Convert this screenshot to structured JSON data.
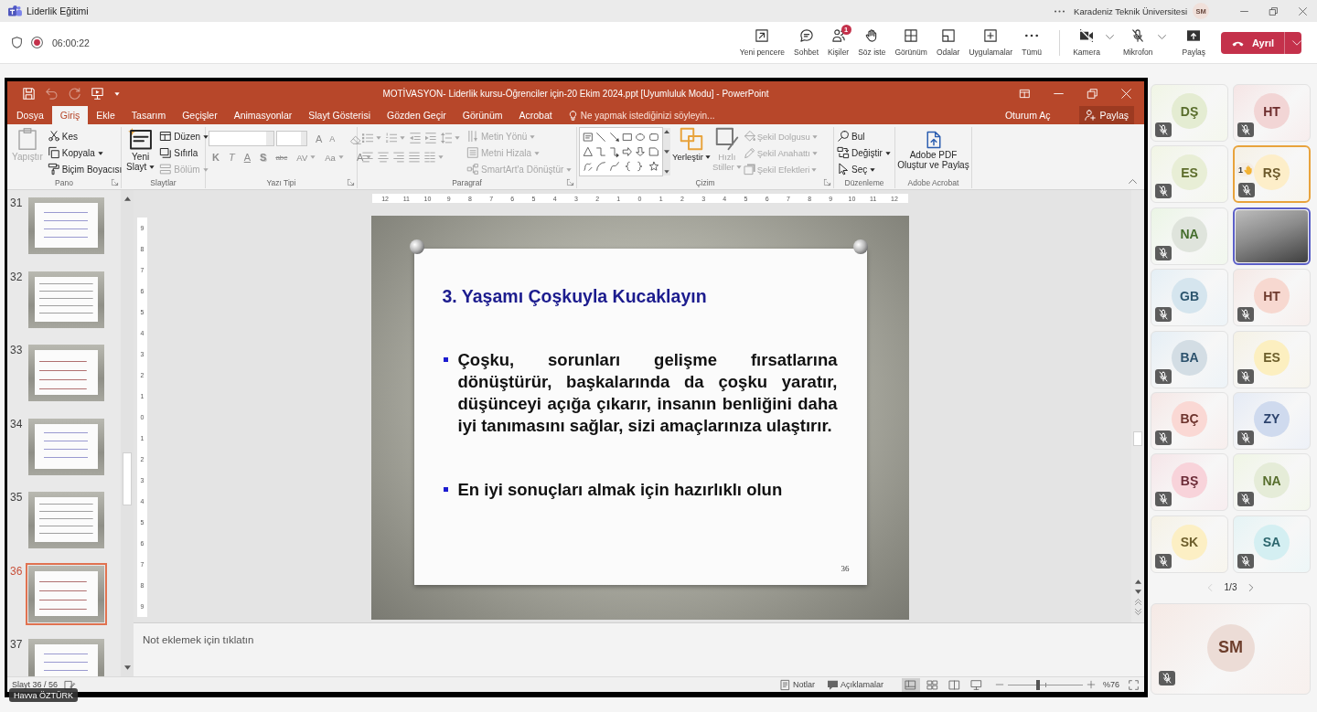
{
  "window": {
    "title": "Liderlik Eğitimi",
    "organization": "Karadeniz Teknik Üniversitesi",
    "user_initials": "SM"
  },
  "meeting_toolbar": {
    "recording": true,
    "timer": "06:00:22",
    "actions": [
      {
        "label": "Yeni pencere"
      },
      {
        "label": "Sohbet"
      },
      {
        "label": "Kişiler",
        "badge": "1"
      },
      {
        "label": "Söz iste"
      },
      {
        "label": "Görünüm"
      },
      {
        "label": "Odalar"
      },
      {
        "label": "Uygulamalar"
      },
      {
        "label": "Tümü"
      }
    ],
    "devices": [
      {
        "label": "Kamera",
        "on": false
      },
      {
        "label": "Mikrofon",
        "on": false
      }
    ],
    "share": {
      "label": "Paylaş"
    },
    "leave": {
      "label": "Ayrıl"
    }
  },
  "shared_screen": {
    "presenter": "Havva ÖZTÜRK",
    "powerpoint": {
      "title": "MOTİVASYON- Liderlik kursu-Öğrenciler için-20 Ekim 2024.ppt [Uyumluluk Modu] - PowerPoint",
      "quick_access": [
        {
          "disabled": false
        },
        {
          "disabled": true
        },
        {
          "disabled": true
        },
        {
          "disabled": false
        }
      ],
      "tabs": [
        {
          "label": "Dosya",
          "selected": false
        },
        {
          "label": "Giriş",
          "selected": true
        },
        {
          "label": "Ekle",
          "selected": false
        },
        {
          "label": "Tasarım",
          "selected": false
        },
        {
          "label": "Geçişler",
          "selected": false
        },
        {
          "label": "Animasyonlar",
          "selected": false
        },
        {
          "label": "Slayt Gösterisi",
          "selected": false
        },
        {
          "label": "Gözden Geçir",
          "selected": false
        },
        {
          "label": "Görünüm",
          "selected": false
        },
        {
          "label": "Acrobat",
          "selected": false
        }
      ],
      "tell_me": {
        "placeholder": "Ne yapmak istediğinizi söyleyin..."
      },
      "sign_in": "Oturum Aç",
      "share": "Paylaş",
      "ribbon": [
        {
          "kind": "clipboard",
          "label": "Pano",
          "launcher": true,
          "commands": [
            {
              "label": "Yapıştır",
              "disabled": true,
              "dropdown": false
            },
            {
              "label": "Kes",
              "disabled": false,
              "dropdown": false
            },
            {
              "label": "Kopyala",
              "disabled": false,
              "dropdown": true
            },
            {
              "label": "Biçim Boyacısı",
              "disabled": false,
              "dropdown": false
            }
          ]
        },
        {
          "kind": "slides",
          "label": "Slaytlar",
          "launcher": false,
          "commands": [
            {
              "label": "Yeni\nSlayt",
              "disabled": false,
              "dropdown": true
            },
            {
              "label": "Düzen",
              "disabled": false,
              "dropdown": true
            },
            {
              "label": "Sıfırla",
              "disabled": false,
              "dropdown": false
            },
            {
              "label": "Bölüm",
              "disabled": true,
              "dropdown": true
            }
          ]
        },
        {
          "kind": "font",
          "label": "Yazı Tipi",
          "launcher": true,
          "disabled": true,
          "size_buttons": [
            "A",
            "A"
          ],
          "format_buttons": [
            {
              "label": "K",
              "dropdown": false
            },
            {
              "label": "T",
              "dropdown": false
            },
            {
              "label": "A",
              "dropdown": false
            },
            {
              "label": "S",
              "dropdown": false
            },
            {
              "label": "abc",
              "dropdown": false
            },
            {
              "label": "AV",
              "dropdown": true
            },
            {
              "label": "Aa",
              "dropdown": true
            },
            {
              "label": "A",
              "dropdown": true
            }
          ]
        },
        {
          "kind": "paragraph",
          "label": "Paragraf",
          "launcher": true,
          "disabled": true,
          "commands": [
            {
              "label": "Metin Yönü",
              "disabled": true,
              "dropdown": true
            },
            {
              "label": "Metni Hizala",
              "disabled": true,
              "dropdown": true
            },
            {
              "label": "SmartArt'a Dönüştür",
              "disabled": true,
              "dropdown": true
            }
          ]
        },
        {
          "kind": "drawing",
          "label": "Çizim",
          "launcher": true,
          "commands": [
            {
              "label": "Yerleştir",
              "disabled": false,
              "dropdown": true
            },
            {
              "label": "Hızlı\nStiller",
              "disabled": true,
              "dropdown": true
            },
            {
              "label": "Şekil Dolgusu",
              "disabled": true,
              "dropdown": true
            },
            {
              "label": "Şekil Anahattı",
              "disabled": true,
              "dropdown": true
            },
            {
              "label": "Şekil Efektleri",
              "disabled": true,
              "dropdown": true
            }
          ]
        },
        {
          "kind": "editing",
          "label": "Düzenleme",
          "launcher": false,
          "commands": [
            {
              "label": "Bul",
              "disabled": false,
              "dropdown": false
            },
            {
              "label": "Değiştir",
              "disabled": false,
              "dropdown": true
            },
            {
              "label": "Seç",
              "disabled": false,
              "dropdown": true
            }
          ]
        },
        {
          "kind": "acrobat",
          "label": "Adobe Acrobat",
          "launcher": false,
          "commands": [
            {
              "label": "Adobe PDF\nOluştur ve Paylaş",
              "disabled": false,
              "dropdown": false
            }
          ]
        }
      ],
      "thumbnails": [
        {
          "number": "31",
          "selected": false
        },
        {
          "number": "32",
          "selected": false
        },
        {
          "number": "33",
          "selected": false
        },
        {
          "number": "34",
          "selected": false
        },
        {
          "number": "35",
          "selected": false
        },
        {
          "number": "36",
          "selected": true
        },
        {
          "number": "37",
          "selected": false
        }
      ],
      "horizontal_ruler": [
        "12",
        "11",
        "10",
        "9",
        "8",
        "7",
        "6",
        "5",
        "4",
        "3",
        "2",
        "1",
        "0",
        "1",
        "2",
        "3",
        "4",
        "5",
        "6",
        "7",
        "8",
        "9",
        "10",
        "11",
        "12"
      ],
      "vertical_ruler": [
        "9",
        "8",
        "7",
        "6",
        "5",
        "4",
        "3",
        "2",
        "1",
        "0",
        "1",
        "2",
        "3",
        "4",
        "5",
        "6",
        "7",
        "8",
        "9"
      ],
      "slide": {
        "title": "3. Yaşamı Çoşkuyla Kucaklayın",
        "bullets": [
          "Çoşku, sorunları gelişme fırsatlarına dönüştürür, başkalarında da çoşku yaratır, düşünceyi açığa çıkarır, insanın benliğini daha iyi tanımasını sağlar, sizi amaçlarınıza ulaştırır.",
          "En iyi sonuçları almak için hazırlıklı olun"
        ],
        "page_number": "36"
      },
      "notes": {
        "placeholder": "Not eklemek için tıklatın"
      },
      "status_bar": {
        "slide_position": "Slayt 36 / 56",
        "notes_label": "Notlar",
        "comments_label": "Açıklamalar",
        "views": [
          {
            "selected": true
          },
          {
            "selected": false
          },
          {
            "selected": false
          },
          {
            "selected": false
          }
        ],
        "zoom": {
          "level": 0.4,
          "label": "%76"
        }
      }
    }
  },
  "participants": {
    "tiles": [
      {
        "initials": "DŞ",
        "color": "#e4ecd2",
        "muted": true,
        "video": false,
        "speaking": false,
        "hand_raised": false
      },
      {
        "initials": "HT",
        "color": "#f2d5d5",
        "muted": true,
        "video": false,
        "speaking": false,
        "hand_raised": false
      },
      {
        "initials": "ES",
        "color": "#e8eed6",
        "muted": true,
        "video": false,
        "speaking": false,
        "hand_raised": false
      },
      {
        "initials": "RŞ",
        "color": "#fdeec9",
        "muted": true,
        "video": false,
        "speaking": false,
        "hand_raised": true,
        "hand_order": "1"
      },
      {
        "initials": "NA",
        "color": "#dfe4dc",
        "muted": true,
        "video": false,
        "speaking": false,
        "hand_raised": false
      },
      {
        "muted": false,
        "video": true,
        "speaking": true,
        "hand_raised": false
      },
      {
        "initials": "GB",
        "color": "#d5e5ee",
        "muted": true,
        "video": false,
        "speaking": false,
        "hand_raised": false
      },
      {
        "initials": "HT",
        "color": "#f7d8d0",
        "muted": true,
        "video": false,
        "speaking": false,
        "hand_raised": false
      },
      {
        "initials": "BA",
        "color": "#d3dde4",
        "muted": true,
        "video": false,
        "speaking": false,
        "hand_raised": false
      },
      {
        "initials": "ES",
        "color": "#fcefc0",
        "muted": true,
        "video": false,
        "speaking": false,
        "hand_raised": false
      },
      {
        "initials": "BÇ",
        "color": "#fad8d4",
        "muted": true,
        "video": false,
        "speaking": false,
        "hand_raised": false
      },
      {
        "initials": "ZY",
        "color": "#cfdaee",
        "muted": true,
        "video": false,
        "speaking": false,
        "hand_raised": false
      },
      {
        "initials": "BŞ",
        "color": "#f8d3da",
        "muted": true,
        "video": false,
        "speaking": false,
        "hand_raised": false
      },
      {
        "initials": "NA",
        "color": "#e5ecd8",
        "muted": true,
        "video": false,
        "speaking": false,
        "hand_raised": false
      },
      {
        "initials": "SK",
        "color": "#fcefc4",
        "muted": true,
        "video": false,
        "speaking": false,
        "hand_raised": false
      },
      {
        "initials": "SA",
        "color": "#d4eff2",
        "muted": true,
        "video": false,
        "speaking": false,
        "hand_raised": false
      }
    ],
    "pager": {
      "label": "1/3",
      "previous_disabled": true
    },
    "self": {
      "initials": "SM",
      "color": "#ecdcd6",
      "muted": true
    }
  }
}
